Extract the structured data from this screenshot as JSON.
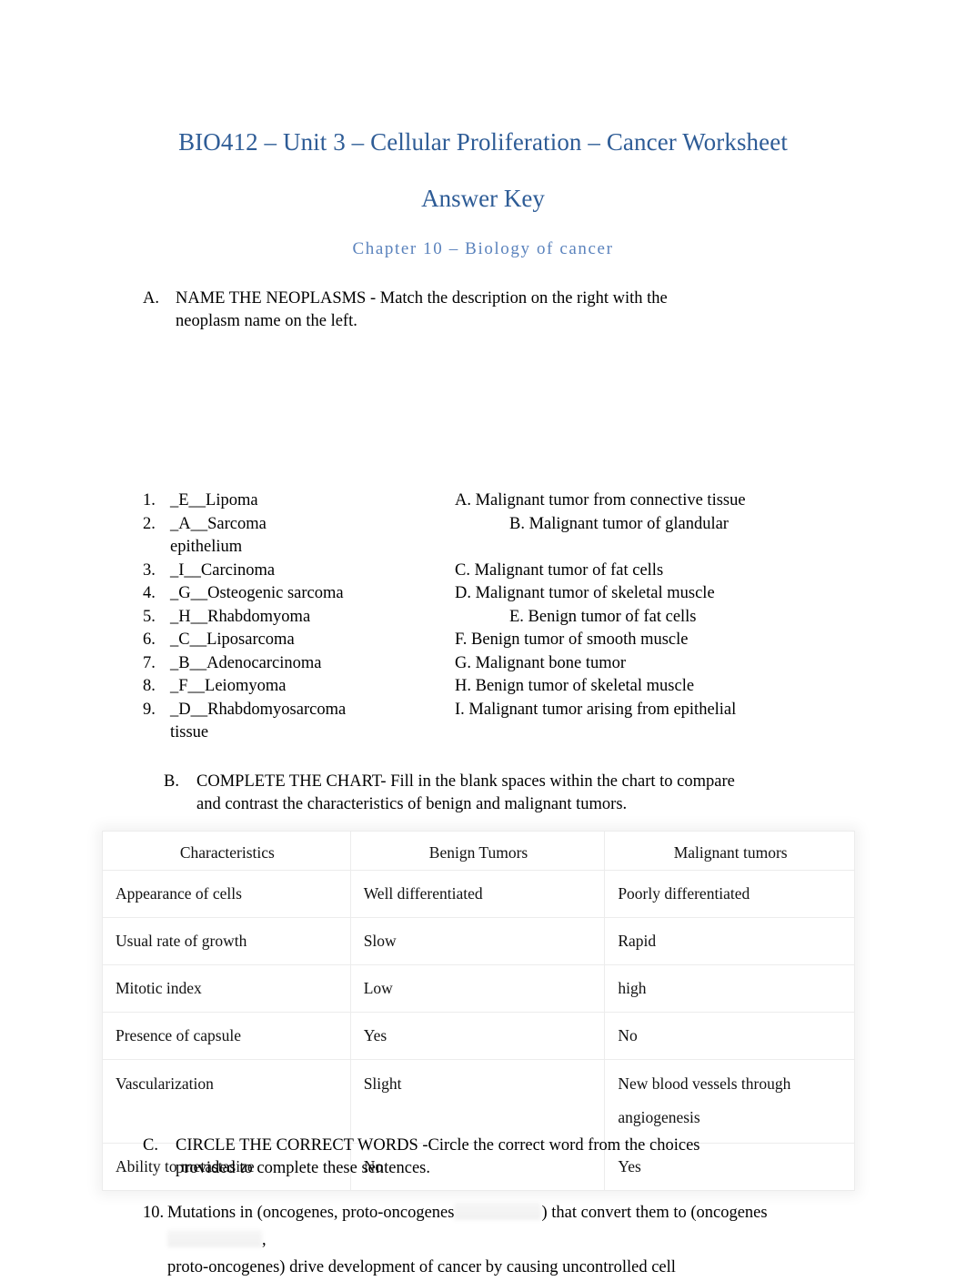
{
  "document": {
    "title": "BIO412 – Unit 3 – Cellular Proliferation – Cancer Worksheet",
    "subtitle": "Answer Key",
    "chapter": "Chapter 10 – Biology of cancer"
  },
  "sections": {
    "a": {
      "letter": "A.",
      "heading": "NAME THE NEOPLASMS - Match the description on the right with the neoplasm name on the left."
    },
    "b": {
      "letter": "B.",
      "heading": "COMPLETE THE CHART- Fill in the blank spaces within the chart to compare and contrast the characteristics of benign and malignant tumors."
    },
    "c": {
      "letter": "C.",
      "heading": "CIRCLE THE CORRECT WORDS -Circle the correct word from the choices provided to complete these sentences."
    }
  },
  "matching": {
    "left": [
      {
        "num": "1.",
        "text": "_E__Lipoma"
      },
      {
        "num": "2.",
        "text": "_A__Sarcoma"
      },
      {
        "num": "3.",
        "text": "_I__Carcinoma"
      },
      {
        "num": "4.",
        "text": "_G__Osteogenic sarcoma"
      },
      {
        "num": "5.",
        "text": "_H__Rhabdomyoma"
      },
      {
        "num": "6.",
        "text": "_C__Liposarcoma"
      },
      {
        "num": "7.",
        "text": "_B__Adenocarcinoma"
      },
      {
        "num": "8.",
        "text": "_F__Leiomyoma"
      },
      {
        "num": "9.",
        "text": "_D__Rhabdomyosarcoma"
      }
    ],
    "left_continuations": {
      "after_item_2": "epithelium",
      "after_item_9": "tissue"
    },
    "right": [
      "A. Malignant tumor from connective tissue",
      "B. Malignant tumor of glandular",
      "C. Malignant tumor of fat cells",
      "D. Malignant tumor of skeletal muscle",
      "E. Benign tumor of fat cells",
      "F. Benign tumor of smooth muscle",
      "G. Malignant bone tumor",
      "H. Benign tumor of skeletal muscle",
      "I. Malignant tumor arising from epithelial"
    ]
  },
  "chart": {
    "headers": [
      "Characteristics",
      "Benign Tumors",
      "Malignant tumors"
    ],
    "rows": [
      [
        "Appearance of cells",
        "Well differentiated",
        "Poorly differentiated"
      ],
      [
        "Usual rate of growth",
        "Slow",
        "Rapid"
      ],
      [
        "Mitotic index",
        "Low",
        "high"
      ],
      [
        "Presence of capsule",
        "Yes",
        "No"
      ],
      [
        "Vascularization",
        "Slight",
        "New blood vessels through angiogenesis"
      ],
      [
        "Ability to metastasize",
        "No",
        "Yes"
      ]
    ]
  },
  "questions": [
    {
      "num": "10.",
      "line1_a": "Mutations in (oncogenes, proto-oncogenes",
      "line1_b": ") that convert them to (oncogenes",
      "line1_c": ",",
      "line2": "proto-oncogenes) drive development of cancer by causing uncontrolled cell"
    }
  ],
  "colors": {
    "heading_blue": "#2e5c96",
    "chapter_blue": "#5b83bd",
    "table_border": "#ececec",
    "body_text": "#000000"
  }
}
